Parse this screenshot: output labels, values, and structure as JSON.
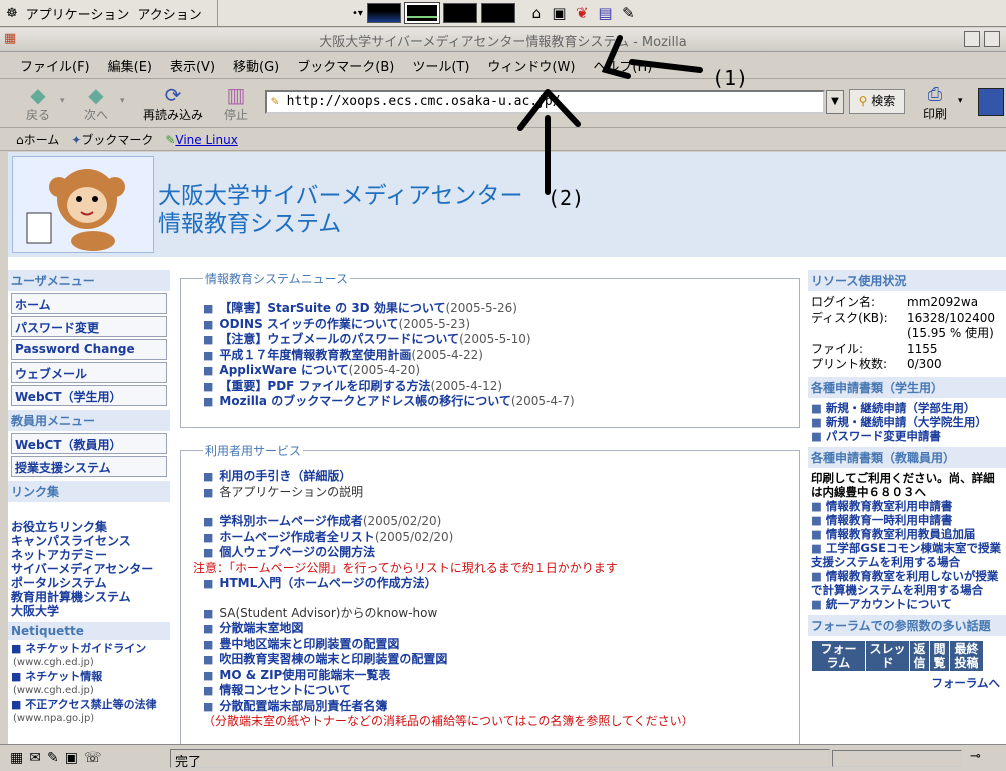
{
  "taskbar": {
    "app_menu": "アプリケーション",
    "action_menu": "アクション"
  },
  "window": {
    "title": "大阪大学サイバーメディアセンター情報教育システム - Mozilla"
  },
  "menubar": [
    "ファイル(F)",
    "編集(E)",
    "表示(V)",
    "移動(G)",
    "ブックマーク(B)",
    "ツール(T)",
    "ウィンドウ(W)",
    "ヘルプ(H)"
  ],
  "navbar": {
    "back": "戻る",
    "forward": "次へ",
    "reload": "再読み込み",
    "stop": "停止",
    "url": "http://xoops.ecs.cmc.osaka-u.ac.jp/",
    "search": "検索",
    "print": "印刷"
  },
  "bookmarks": {
    "home": "ホーム",
    "bookmarks": "ブックマーク",
    "vine": "Vine Linux"
  },
  "banner": {
    "line1": "大阪大学サイバーメディアセンター",
    "line2": "情報教育システム"
  },
  "left": {
    "user_menu_head": "ユーザメニュー",
    "user_menu": [
      "ホーム",
      "パスワード変更",
      "Password Change",
      "ウェブメール",
      "WebCT（学生用）"
    ],
    "staff_menu_head": "教員用メニュー",
    "staff_menu": [
      "WebCT（教員用）",
      "授業支援システム"
    ],
    "links_head": "リンク集",
    "links": [
      "お役立ちリンク集",
      "キャンパスライセンス",
      "ネットアカデミー",
      "サイバーメディアセンター",
      "ポータルシステム",
      "教育用計算機システム",
      "大阪大学"
    ],
    "netiquette_head": "Netiquette",
    "netiquette": [
      {
        "label": "ネチケットガイドライン",
        "site": "(www.cgh.ed.jp)"
      },
      {
        "label": "ネチケット情報",
        "site": "(www.cgh.ed.jp)"
      },
      {
        "label": "不正アクセス禁止等の法律",
        "site": "(www.npa.go.jp)"
      }
    ]
  },
  "news": {
    "legend": "情報教育システムニュース",
    "items": [
      {
        "title": "【障害】StarSuite の 3D 効果について",
        "date": "(2005-5-26)"
      },
      {
        "title": "ODINS スイッチの作業について",
        "date": "(2005-5-23)"
      },
      {
        "title": "【注意】ウェブメールのパスワードについて",
        "date": "(2005-5-10)"
      },
      {
        "title": "平成１７年度情報教育教室使用計画",
        "date": "(2005-4-22)"
      },
      {
        "title": "ApplixWare について",
        "date": "(2005-4-20)"
      },
      {
        "title": "【重要】PDF ファイルを印刷する方法",
        "date": "(2005-4-12)"
      },
      {
        "title": "Mozilla のブックマークとアドレス帳の移行について",
        "date": "(2005-4-7)"
      }
    ]
  },
  "services": {
    "legend": "利用者用サービス",
    "guide": "利用の手引き（詳細版）",
    "apps": "各アプリケーションの説明",
    "hp_make": "学科別ホームページ作成者",
    "hp_make_date": "(2005/02/20)",
    "hp_list": "ホームページ作成者全リスト",
    "hp_list_date": "(2005/02/20)",
    "personal_hp": "個人ウェブページの公開方法",
    "note": "注意：「ホームページ公開」を行ってからリストに現れるまで約１日かかります",
    "html_intro": "HTML入門（ホームページの作成方法）",
    "sa_howto": "SA(Student Advisor)からのknow-how",
    "sa_items": [
      "分散端末室地図",
      "豊中地区端末と印刷装置の配置図",
      "吹田教育実習棟の端末と印刷装置の配置図",
      "MO & ZIP使用可能端末一覧表",
      "情報コンセントについて",
      "分散配置端末部局別責任者名簿"
    ],
    "supplies_note": "（分散端末室の紙やトナーなどの消耗品の補給等についてはこの名簿を参照してください）"
  },
  "right": {
    "resource_head": "リソース使用状況",
    "login_label": "ログイン名:",
    "login_value": "mm2092wa",
    "disk_label": "ディスク(KB):",
    "disk_value": "16328/102400",
    "disk_pct": "(15.95 % 使用)",
    "files_label": "ファイル:",
    "files_value": "1155",
    "print_label": "プリント枚数:",
    "print_value": "0/300",
    "forms_student_head": "各種申請書類（学生用）",
    "forms_student": [
      "新規・継続申請（学部生用）",
      "新規・継続申請（大学院生用）",
      "パスワード変更申請書"
    ],
    "forms_staff_head": "各種申請書類（教職員用）",
    "forms_staff_note1": "印刷してご利用ください。尚、詳細",
    "forms_staff_note2": "は内線豊中６８０３へ",
    "forms_staff": [
      "情報教育教室利用申請書",
      "情報教育一時利用申請書",
      "情報教育教室利用教員追加届",
      "工学部GSEコモン棟端末室で授業支援システムを利用する場合",
      "情報教育教室を利用しないが授業で計算機システムを利用する場合",
      "統一アカウントについて"
    ],
    "forum_head": "フォーラムでの参照数の多い話題",
    "forum_cols": [
      "フォーラム",
      "スレッド",
      "返信",
      "閲覧",
      "最終投稿"
    ],
    "forum_link": "フォーラムへ"
  },
  "status": {
    "text": "完了"
  },
  "annotations": {
    "one": "(1)",
    "two": "(2)"
  }
}
